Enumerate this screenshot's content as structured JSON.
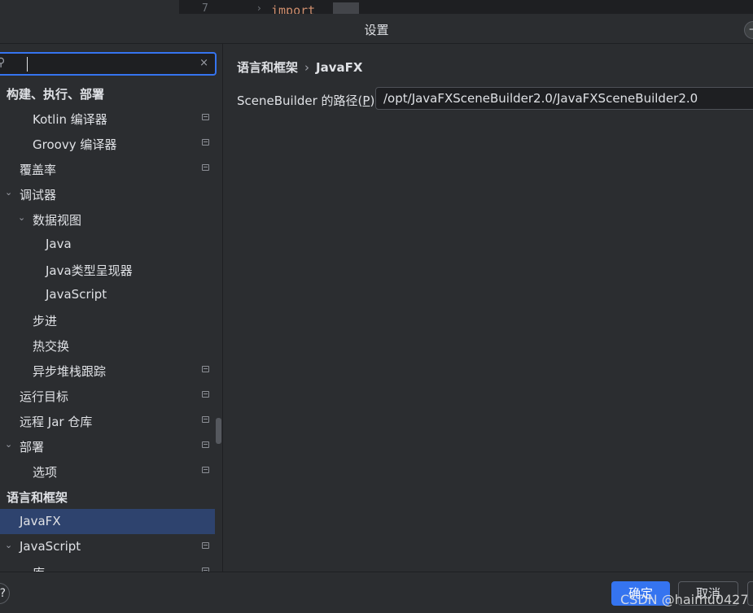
{
  "editor": {
    "line_number": "7",
    "code_fragment": "import"
  },
  "dialog": {
    "title": "设置",
    "window_button": "–"
  },
  "search": {
    "icon": "search-icon",
    "value": "",
    "clear_icon": "×"
  },
  "tree": [
    {
      "label": "构建、执行、部署",
      "bold": true,
      "indent": 0,
      "chevron": "",
      "marker": false
    },
    {
      "label": "Kotlin 编译器",
      "bold": false,
      "indent": 2,
      "chevron": "",
      "marker": true
    },
    {
      "label": "Groovy 编译器",
      "bold": false,
      "indent": 2,
      "chevron": "",
      "marker": true
    },
    {
      "label": "覆盖率",
      "bold": false,
      "indent": 1,
      "chevron": "",
      "marker": true
    },
    {
      "label": "调试器",
      "bold": false,
      "indent": 1,
      "chevron": "expanded",
      "marker": false
    },
    {
      "label": "数据视图",
      "bold": false,
      "indent": 2,
      "chevron": "expanded",
      "marker": false
    },
    {
      "label": "Java",
      "bold": false,
      "indent": 3,
      "chevron": "",
      "marker": false
    },
    {
      "label": "Java类型呈现器",
      "bold": false,
      "indent": 3,
      "chevron": "",
      "marker": false
    },
    {
      "label": "JavaScript",
      "bold": false,
      "indent": 3,
      "chevron": "",
      "marker": false
    },
    {
      "label": "步进",
      "bold": false,
      "indent": 2,
      "chevron": "",
      "marker": false
    },
    {
      "label": "热交换",
      "bold": false,
      "indent": 2,
      "chevron": "",
      "marker": false
    },
    {
      "label": "异步堆栈跟踪",
      "bold": false,
      "indent": 2,
      "chevron": "",
      "marker": true
    },
    {
      "label": "运行目标",
      "bold": false,
      "indent": 1,
      "chevron": "",
      "marker": true
    },
    {
      "label": "远程 Jar 仓库",
      "bold": false,
      "indent": 1,
      "chevron": "",
      "marker": true
    },
    {
      "label": "部署",
      "bold": false,
      "indent": 1,
      "chevron": "expanded",
      "marker": true
    },
    {
      "label": "选项",
      "bold": false,
      "indent": 2,
      "chevron": "",
      "marker": true
    },
    {
      "label": "语言和框架",
      "bold": true,
      "indent": 0,
      "chevron": "",
      "marker": false
    },
    {
      "label": "JavaFX",
      "bold": false,
      "indent": 1,
      "chevron": "",
      "marker": false,
      "selected": true
    },
    {
      "label": "JavaScript",
      "bold": false,
      "indent": 1,
      "chevron": "expanded",
      "marker": true
    },
    {
      "label": "库",
      "bold": false,
      "indent": 2,
      "chevron": "",
      "marker": true
    }
  ],
  "main": {
    "breadcrumb_parent": "语言和框架",
    "breadcrumb_separator": "›",
    "breadcrumb_current": "JavaFX",
    "field_label_prefix": "SceneBuilder 的路径(",
    "field_label_mnemonic": "P",
    "field_label_suffix": "):",
    "field_value": "/opt/JavaFXSceneBuilder2.0/JavaFXSceneBuilder2.0"
  },
  "footer": {
    "help_label": "?",
    "ok_label": "确定",
    "cancel_label": "取消",
    "watermark": "CSDN @haimu0427"
  },
  "colors": {
    "accent": "#3574f0",
    "selection": "#2e436e",
    "background": "#2b2d30"
  }
}
